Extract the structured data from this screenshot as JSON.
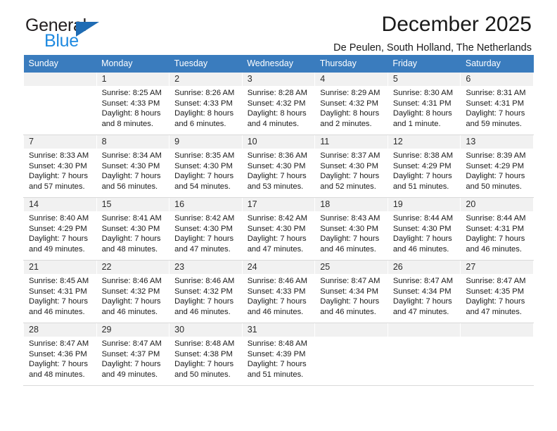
{
  "brand": {
    "name_top": "General",
    "name_bottom": "Blue",
    "accent_color": "#1f8ae0",
    "triangle_color": "#1f6cb4",
    "triangle_icon": "triangle-right-icon"
  },
  "header": {
    "title": "December 2025",
    "subtitle": "De Peulen, South Holland, The Netherlands"
  },
  "calendar": {
    "header_background": "#3a7cbe",
    "header_text_color": "#ffffff",
    "weekday_headers": [
      "Sunday",
      "Monday",
      "Tuesday",
      "Wednesday",
      "Thursday",
      "Friday",
      "Saturday"
    ],
    "weeks": [
      {
        "shaded": true,
        "days": [
          {
            "day": "",
            "lines": []
          },
          {
            "day": "1",
            "lines": [
              "Sunrise: 8:25 AM",
              "Sunset: 4:33 PM",
              "Daylight: 8 hours",
              "and 8 minutes."
            ]
          },
          {
            "day": "2",
            "lines": [
              "Sunrise: 8:26 AM",
              "Sunset: 4:33 PM",
              "Daylight: 8 hours",
              "and 6 minutes."
            ]
          },
          {
            "day": "3",
            "lines": [
              "Sunrise: 8:28 AM",
              "Sunset: 4:32 PM",
              "Daylight: 8 hours",
              "and 4 minutes."
            ]
          },
          {
            "day": "4",
            "lines": [
              "Sunrise: 8:29 AM",
              "Sunset: 4:32 PM",
              "Daylight: 8 hours",
              "and 2 minutes."
            ]
          },
          {
            "day": "5",
            "lines": [
              "Sunrise: 8:30 AM",
              "Sunset: 4:31 PM",
              "Daylight: 8 hours",
              "and 1 minute."
            ]
          },
          {
            "day": "6",
            "lines": [
              "Sunrise: 8:31 AM",
              "Sunset: 4:31 PM",
              "Daylight: 7 hours",
              "and 59 minutes."
            ]
          }
        ]
      },
      {
        "shaded": true,
        "days": [
          {
            "day": "7",
            "lines": [
              "Sunrise: 8:33 AM",
              "Sunset: 4:30 PM",
              "Daylight: 7 hours",
              "and 57 minutes."
            ]
          },
          {
            "day": "8",
            "lines": [
              "Sunrise: 8:34 AM",
              "Sunset: 4:30 PM",
              "Daylight: 7 hours",
              "and 56 minutes."
            ]
          },
          {
            "day": "9",
            "lines": [
              "Sunrise: 8:35 AM",
              "Sunset: 4:30 PM",
              "Daylight: 7 hours",
              "and 54 minutes."
            ]
          },
          {
            "day": "10",
            "lines": [
              "Sunrise: 8:36 AM",
              "Sunset: 4:30 PM",
              "Daylight: 7 hours",
              "and 53 minutes."
            ]
          },
          {
            "day": "11",
            "lines": [
              "Sunrise: 8:37 AM",
              "Sunset: 4:30 PM",
              "Daylight: 7 hours",
              "and 52 minutes."
            ]
          },
          {
            "day": "12",
            "lines": [
              "Sunrise: 8:38 AM",
              "Sunset: 4:29 PM",
              "Daylight: 7 hours",
              "and 51 minutes."
            ]
          },
          {
            "day": "13",
            "lines": [
              "Sunrise: 8:39 AM",
              "Sunset: 4:29 PM",
              "Daylight: 7 hours",
              "and 50 minutes."
            ]
          }
        ]
      },
      {
        "shaded": true,
        "days": [
          {
            "day": "14",
            "lines": [
              "Sunrise: 8:40 AM",
              "Sunset: 4:29 PM",
              "Daylight: 7 hours",
              "and 49 minutes."
            ]
          },
          {
            "day": "15",
            "lines": [
              "Sunrise: 8:41 AM",
              "Sunset: 4:30 PM",
              "Daylight: 7 hours",
              "and 48 minutes."
            ]
          },
          {
            "day": "16",
            "lines": [
              "Sunrise: 8:42 AM",
              "Sunset: 4:30 PM",
              "Daylight: 7 hours",
              "and 47 minutes."
            ]
          },
          {
            "day": "17",
            "lines": [
              "Sunrise: 8:42 AM",
              "Sunset: 4:30 PM",
              "Daylight: 7 hours",
              "and 47 minutes."
            ]
          },
          {
            "day": "18",
            "lines": [
              "Sunrise: 8:43 AM",
              "Sunset: 4:30 PM",
              "Daylight: 7 hours",
              "and 46 minutes."
            ]
          },
          {
            "day": "19",
            "lines": [
              "Sunrise: 8:44 AM",
              "Sunset: 4:30 PM",
              "Daylight: 7 hours",
              "and 46 minutes."
            ]
          },
          {
            "day": "20",
            "lines": [
              "Sunrise: 8:44 AM",
              "Sunset: 4:31 PM",
              "Daylight: 7 hours",
              "and 46 minutes."
            ]
          }
        ]
      },
      {
        "shaded": true,
        "days": [
          {
            "day": "21",
            "lines": [
              "Sunrise: 8:45 AM",
              "Sunset: 4:31 PM",
              "Daylight: 7 hours",
              "and 46 minutes."
            ]
          },
          {
            "day": "22",
            "lines": [
              "Sunrise: 8:46 AM",
              "Sunset: 4:32 PM",
              "Daylight: 7 hours",
              "and 46 minutes."
            ]
          },
          {
            "day": "23",
            "lines": [
              "Sunrise: 8:46 AM",
              "Sunset: 4:32 PM",
              "Daylight: 7 hours",
              "and 46 minutes."
            ]
          },
          {
            "day": "24",
            "lines": [
              "Sunrise: 8:46 AM",
              "Sunset: 4:33 PM",
              "Daylight: 7 hours",
              "and 46 minutes."
            ]
          },
          {
            "day": "25",
            "lines": [
              "Sunrise: 8:47 AM",
              "Sunset: 4:34 PM",
              "Daylight: 7 hours",
              "and 46 minutes."
            ]
          },
          {
            "day": "26",
            "lines": [
              "Sunrise: 8:47 AM",
              "Sunset: 4:34 PM",
              "Daylight: 7 hours",
              "and 47 minutes."
            ]
          },
          {
            "day": "27",
            "lines": [
              "Sunrise: 8:47 AM",
              "Sunset: 4:35 PM",
              "Daylight: 7 hours",
              "and 47 minutes."
            ]
          }
        ]
      },
      {
        "shaded": true,
        "days": [
          {
            "day": "28",
            "lines": [
              "Sunrise: 8:47 AM",
              "Sunset: 4:36 PM",
              "Daylight: 7 hours",
              "and 48 minutes."
            ]
          },
          {
            "day": "29",
            "lines": [
              "Sunrise: 8:47 AM",
              "Sunset: 4:37 PM",
              "Daylight: 7 hours",
              "and 49 minutes."
            ]
          },
          {
            "day": "30",
            "lines": [
              "Sunrise: 8:48 AM",
              "Sunset: 4:38 PM",
              "Daylight: 7 hours",
              "and 50 minutes."
            ]
          },
          {
            "day": "31",
            "lines": [
              "Sunrise: 8:48 AM",
              "Sunset: 4:39 PM",
              "Daylight: 7 hours",
              "and 51 minutes."
            ]
          },
          {
            "day": "",
            "lines": []
          },
          {
            "day": "",
            "lines": []
          },
          {
            "day": "",
            "lines": []
          }
        ]
      }
    ]
  }
}
